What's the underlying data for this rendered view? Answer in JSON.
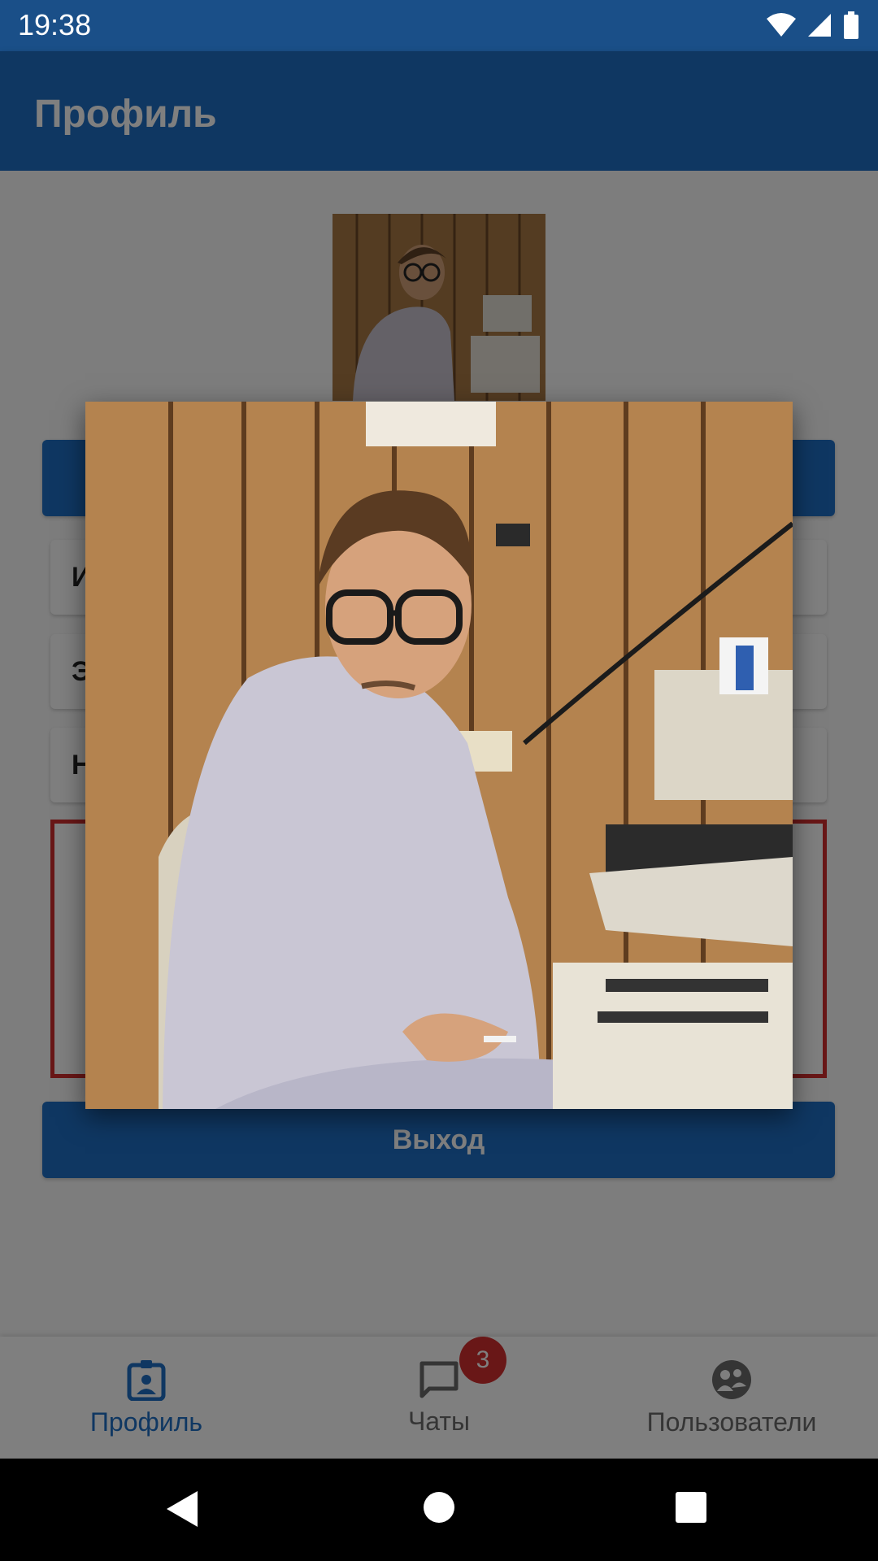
{
  "status_bar": {
    "time": "19:38",
    "icons": [
      "wifi-icon",
      "signal-icon",
      "battery-icon"
    ]
  },
  "app_bar": {
    "title": "Профиль"
  },
  "profile": {
    "field_initials": [
      "И",
      "Э",
      "Н"
    ]
  },
  "actions": {
    "logout_label": "Выход"
  },
  "bottom_nav": {
    "items": [
      {
        "label": "Профиль",
        "icon": "profile-badge-icon",
        "active": true
      },
      {
        "label": "Чаты",
        "icon": "chat-icon",
        "badge": "3"
      },
      {
        "label": "Пользователи",
        "icon": "users-icon"
      }
    ]
  },
  "colors": {
    "primary": "#1f6fc5",
    "status_bar": "#1a4f88",
    "error": "#d32f2f"
  }
}
